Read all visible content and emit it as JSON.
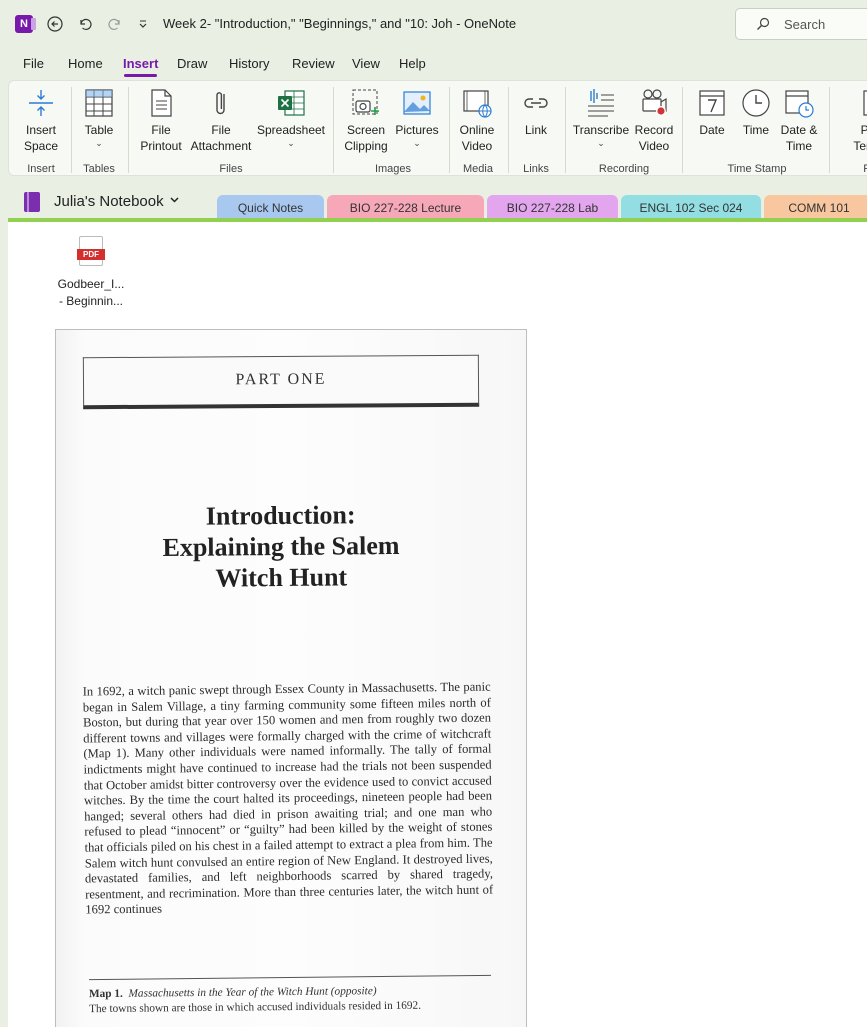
{
  "window": {
    "title": "Week 2- \"Introduction,\" \"Beginnings,\" and \"10: Joh  -  OneNote",
    "app_icon_letter": "N",
    "search_placeholder": "Search"
  },
  "menu": [
    "File",
    "Home",
    "Insert",
    "Draw",
    "History",
    "Review",
    "View",
    "Help"
  ],
  "active_menu": "Insert",
  "ribbon": {
    "insert_space": "Insert\nSpace",
    "table": "Table",
    "file_printout": "File\nPrintout",
    "file_attachment": "File\nAttachment",
    "spreadsheet": "Spreadsheet",
    "screen_clipping": "Screen\nClipping",
    "pictures": "Pictures",
    "online_video": "Online\nVideo",
    "link": "Link",
    "transcribe": "Transcribe",
    "record_video": "Record\nVideo",
    "date": "Date",
    "time": "Time",
    "date_time": "Date &\nTime",
    "page_templates": "Pa\nTemp",
    "groups": {
      "insert": "Insert",
      "tables": "Tables",
      "files": "Files",
      "images": "Images",
      "media": "Media",
      "links": "Links",
      "recording": "Recording",
      "time_stamp": "Time Stamp",
      "pages": "Pa"
    }
  },
  "notebook": {
    "name": "Julia's Notebook",
    "sections": [
      {
        "label": "Quick Notes",
        "color": "#a8c8ef"
      },
      {
        "label": "BIO 227-228 Lecture",
        "color": "#f7a8b8"
      },
      {
        "label": "BIO 227-228 Lab",
        "color": "#e3a6ee"
      },
      {
        "label": "ENGL 102 Sec 024",
        "color": "#93dee2"
      },
      {
        "label": "COMM 101",
        "color": "#f8c7a0"
      }
    ]
  },
  "attachment": {
    "icon_text": "PDF",
    "name_line1": "Godbeer_I...",
    "name_line2": "- Beginnin..."
  },
  "scan": {
    "part": "PART ONE",
    "title_line1": "Introduction:",
    "title_line2": "Explaining the Salem",
    "title_line3": "Witch Hunt",
    "body": "In 1692, a witch panic swept through Essex County in Massachusetts. The panic began in Salem Village, a tiny farming community some fifteen miles north of Boston, but during that year over 150 women and men from roughly two dozen different towns and villages were formally charged with the crime of witchcraft (Map 1). Many other individuals were named informally. The tally of formal indictments might have continued to increase had the trials not been suspended that October amidst bitter controversy over the evidence used to convict accused witches. By the time the court halted its proceedings, nineteen people had been hanged; several others had died in prison awaiting trial; and one man who refused to plead “innocent” or “guilty” had been killed by the weight of stones that officials piled on his chest in a failed attempt to extract a plea from him. The Salem witch hunt convulsed an entire region of New England. It destroyed lives, devastated families, and left neighborhoods scarred by shared tragedy, resentment, and recrimination. More than three centuries later, the witch hunt of 1692 continues",
    "map_label": "Map 1.",
    "map_title": "Massachusetts in the Year of the Witch Hunt (opposite)",
    "map_caption": "The towns shown are those in which accused individuals resided in 1692."
  },
  "colors": {
    "accent": "#7719aa",
    "page_bar": "#92d050",
    "background": "#e9efe2"
  }
}
